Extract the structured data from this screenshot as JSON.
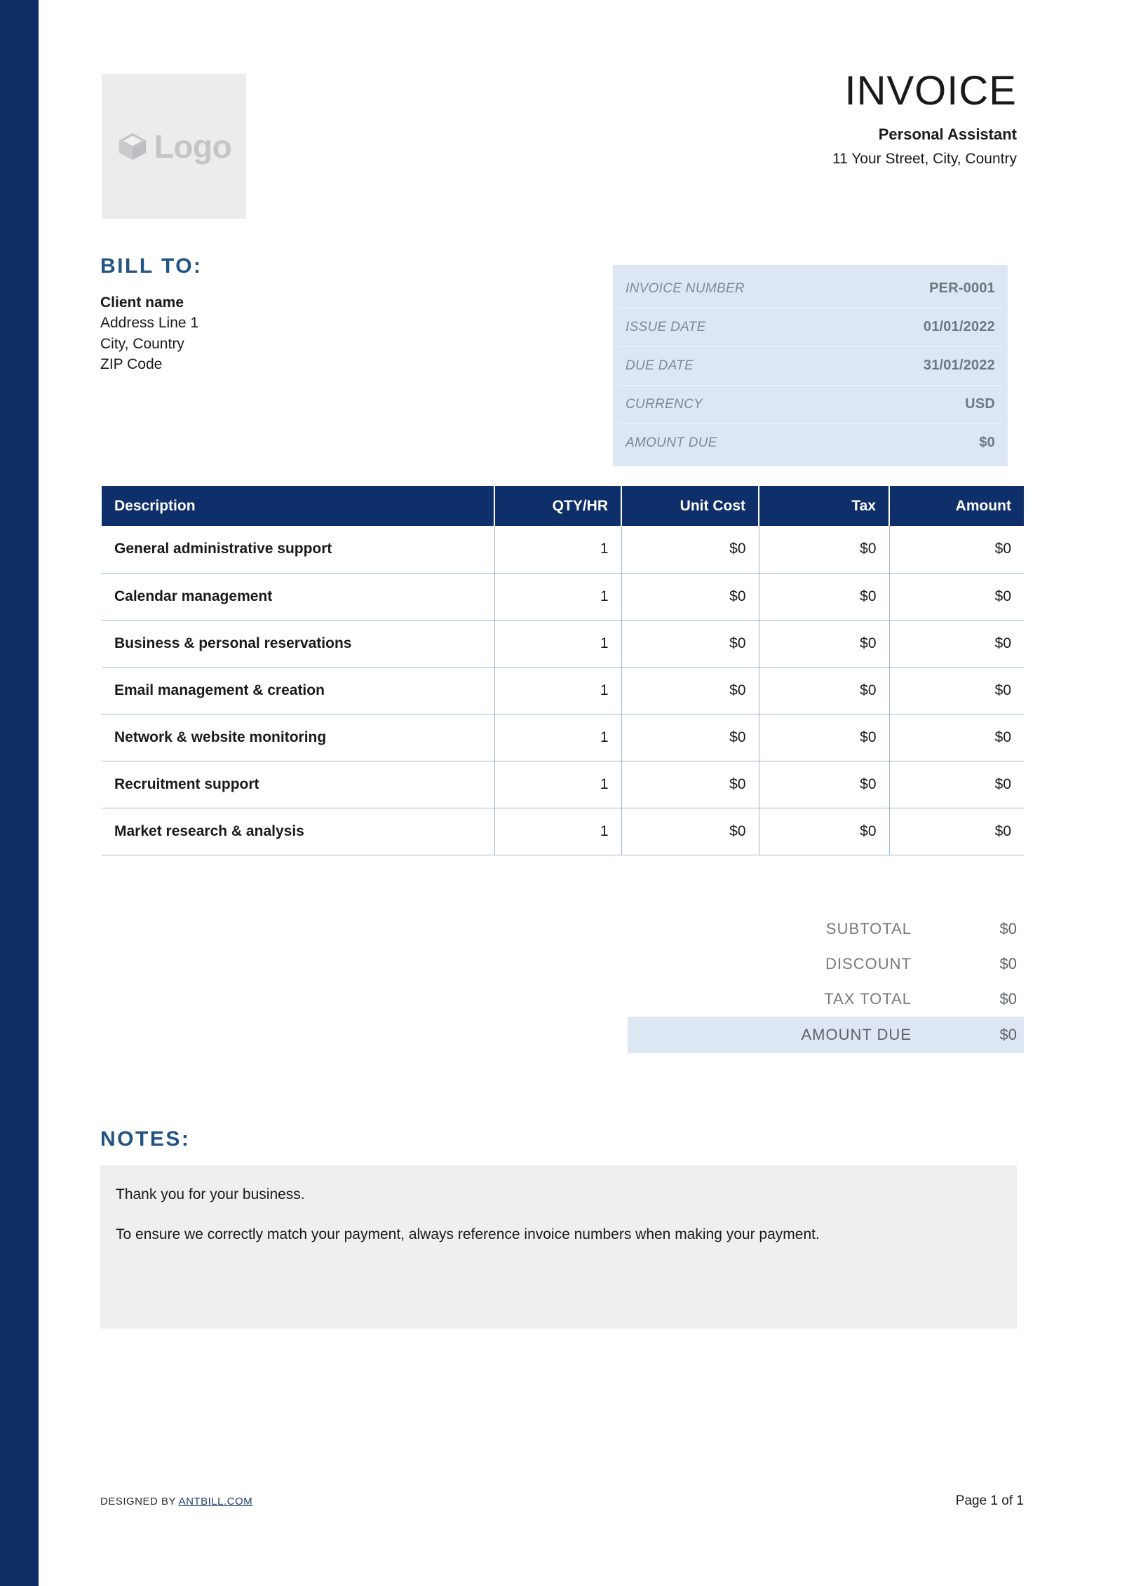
{
  "header": {
    "logo": {
      "icon": "cube-icon",
      "text": "Logo"
    },
    "doc_title": "INVOICE",
    "company_name": "Personal Assistant",
    "company_address": "11 Your Street, City, Country"
  },
  "bill_to": {
    "heading": "BILL TO:",
    "client_name": "Client name",
    "address_line_1": "Address Line 1",
    "city_country": "City, Country",
    "zip_code": "ZIP Code"
  },
  "invoice_meta": {
    "rows": [
      {
        "label": "INVOICE NUMBER",
        "value": "PER-0001"
      },
      {
        "label": "ISSUE DATE",
        "value": "01/01/2022"
      },
      {
        "label": "DUE DATE",
        "value": "31/01/2022"
      },
      {
        "label": "CURRENCY",
        "value": "USD"
      },
      {
        "label": "AMOUNT DUE",
        "value": "$0"
      }
    ]
  },
  "items_table": {
    "columns": [
      "Description",
      "QTY/HR",
      "Unit Cost",
      "Tax",
      "Amount"
    ],
    "rows": [
      {
        "description": "General administrative support",
        "qty": "1",
        "unit_cost": "$0",
        "tax": "$0",
        "amount": "$0"
      },
      {
        "description": "Calendar management",
        "qty": "1",
        "unit_cost": "$0",
        "tax": "$0",
        "amount": "$0"
      },
      {
        "description": "Business & personal reservations",
        "qty": "1",
        "unit_cost": "$0",
        "tax": "$0",
        "amount": "$0"
      },
      {
        "description": "Email management & creation",
        "qty": "1",
        "unit_cost": "$0",
        "tax": "$0",
        "amount": "$0"
      },
      {
        "description": "Network & website monitoring",
        "qty": "1",
        "unit_cost": "$0",
        "tax": "$0",
        "amount": "$0"
      },
      {
        "description": "Recruitment support",
        "qty": "1",
        "unit_cost": "$0",
        "tax": "$0",
        "amount": "$0"
      },
      {
        "description": "Market research & analysis",
        "qty": "1",
        "unit_cost": "$0",
        "tax": "$0",
        "amount": "$0"
      }
    ]
  },
  "totals": {
    "subtotal_label": "SUBTOTAL",
    "subtotal_value": "$0",
    "discount_label": "DISCOUNT",
    "discount_value": "$0",
    "tax_total_label": "TAX TOTAL",
    "tax_total_value": "$0",
    "amount_due_label": "AMOUNT DUE",
    "amount_due_value": "$0"
  },
  "notes": {
    "heading": "NOTES:",
    "paragraph_1": "Thank you for your business.",
    "paragraph_2": "To ensure we correctly match your payment, always reference invoice numbers when making your payment."
  },
  "footer": {
    "designed_by_prefix": "DESIGNED BY ",
    "designed_by_link": "ANTBILL.COM",
    "page_indicator": "Page 1 of 1"
  },
  "colors": {
    "navy_bar": "#0d2d63",
    "table_header": "#0f2f6b",
    "accent_heading": "#225382",
    "meta_box_bg": "#dde7f4",
    "notes_bg": "#efefef",
    "table_border": "#9cb7d6",
    "logo_placeholder_bg": "#ececec"
  }
}
